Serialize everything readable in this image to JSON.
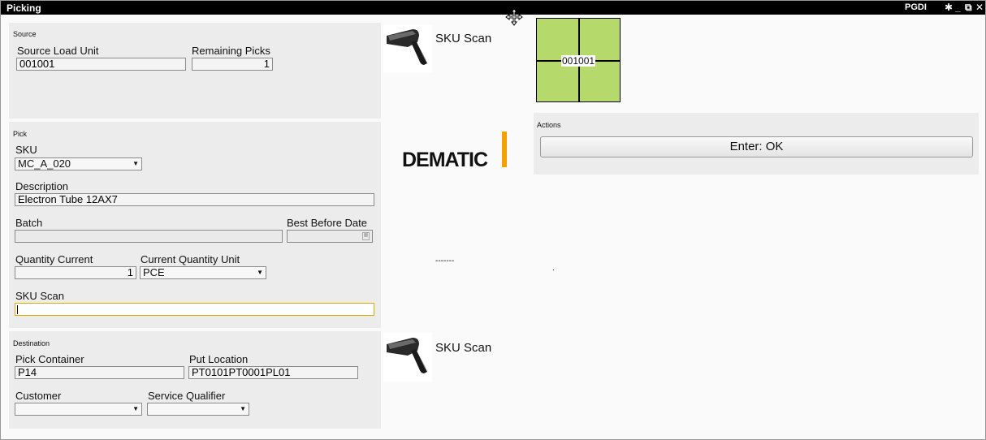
{
  "window": {
    "title": "Picking",
    "app_label": "PGDI",
    "controls": {
      "pin": "✱",
      "minimize": "_",
      "restore": "⧉",
      "close": "✕"
    }
  },
  "source": {
    "title": "Source",
    "load_unit_label": "Source Load Unit",
    "load_unit_value": "001001",
    "remaining_label": "Remaining Picks",
    "remaining_value": "1"
  },
  "pick": {
    "title": "Pick",
    "sku_label": "SKU",
    "sku_value": "MC_A_020",
    "description_label": "Description",
    "description_value": "Electron Tube 12AX7",
    "batch_label": "Batch",
    "batch_value": "",
    "best_before_label": "Best Before Date",
    "best_before_value": "",
    "qty_current_label": "Quantity Current",
    "qty_current_value": "1",
    "qty_unit_label": "Current Quantity Unit",
    "qty_unit_value": "PCE",
    "sku_scan_label": "SKU Scan",
    "sku_scan_value": ""
  },
  "destination": {
    "title": "Destination",
    "pick_container_label": "Pick Container",
    "pick_container_value": "P14",
    "put_location_label": "Put Location",
    "put_location_value": "PT0101PT0001PL01",
    "customer_label": "Customer",
    "customer_value": "",
    "service_qualifier_label": "Service Qualifier",
    "service_qualifier_value": ""
  },
  "scan_top": {
    "label": "SKU Scan",
    "icon": "barcode-scanner-icon"
  },
  "scan_bottom": {
    "label": "SKU Scan",
    "icon": "barcode-scanner-icon"
  },
  "logo": {
    "text": "DEMATIC",
    "accent": "#f2a100"
  },
  "load_unit_map": {
    "label": "001001",
    "color": "#b5d96a"
  },
  "misc": {
    "dashes": "-------",
    "dot": "."
  },
  "actions": {
    "title": "Actions",
    "enter_label": "Enter: OK"
  }
}
